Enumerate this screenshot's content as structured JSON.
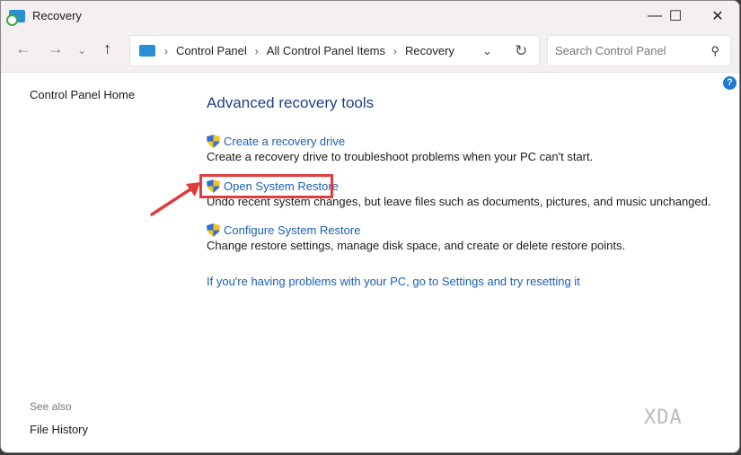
{
  "window": {
    "title": "Recovery"
  },
  "address": {
    "crumbs": [
      "Control Panel",
      "All Control Panel Items",
      "Recovery"
    ]
  },
  "search": {
    "placeholder": "Search Control Panel"
  },
  "sidebar": {
    "home": "Control Panel Home",
    "see_also": "See also",
    "file_history": "File History"
  },
  "main": {
    "heading": "Advanced recovery tools",
    "tasks": [
      {
        "link": "Create a recovery drive",
        "desc": "Create a recovery drive to troubleshoot problems when your PC can't start."
      },
      {
        "link": "Open System Restore",
        "desc": "Undo recent system changes, but leave files such as documents, pictures, and music unchanged."
      },
      {
        "link": "Configure System Restore",
        "desc": "Change restore settings, manage disk space, and create or delete restore points."
      }
    ],
    "reset_link": "If you're having problems with your PC, go to Settings and try resetting it"
  },
  "watermark": "XDA",
  "colors": {
    "link": "#1a5fb4",
    "highlight": "#e03c3c"
  }
}
